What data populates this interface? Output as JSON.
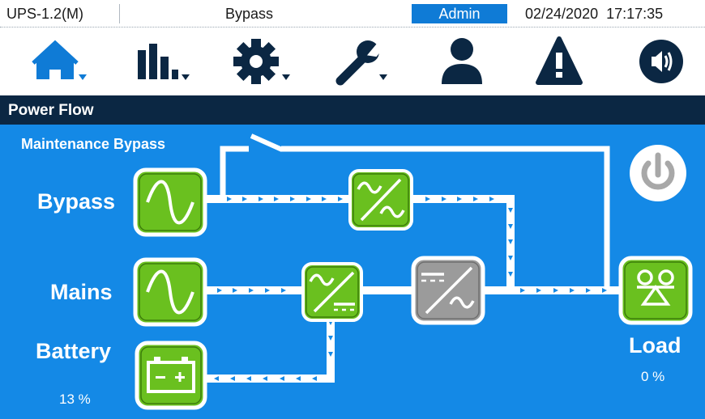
{
  "status_bar": {
    "model": "UPS-1.2(M)",
    "mode": "Bypass",
    "user": "Admin",
    "datetime": "02/24/2020  17:17:35"
  },
  "nav": {
    "items": [
      {
        "icon": "home-icon",
        "has_dropdown": true,
        "active": true
      },
      {
        "icon": "bar-chart-icon",
        "has_dropdown": true
      },
      {
        "icon": "gear-icon",
        "has_dropdown": true
      },
      {
        "icon": "wrench-icon",
        "has_dropdown": true
      },
      {
        "icon": "user-icon",
        "has_dropdown": false
      },
      {
        "icon": "warning-icon",
        "has_dropdown": false
      },
      {
        "icon": "speaker-icon",
        "has_dropdown": false
      }
    ]
  },
  "panel": {
    "title": "Power Flow"
  },
  "diagram": {
    "maintenance_bypass_label": "Maintenance Bypass",
    "bypass_label": "Bypass",
    "mains_label": "Mains",
    "battery_label": "Battery",
    "battery_percent": "13 %",
    "load_label": "Load",
    "load_percent": "0 %",
    "components": [
      {
        "name": "bypass-source",
        "icon": "ac-sine-icon",
        "state": "active"
      },
      {
        "name": "mains-source",
        "icon": "ac-sine-icon",
        "state": "active"
      },
      {
        "name": "battery",
        "icon": "battery-icon",
        "state": "active"
      },
      {
        "name": "bypass-static-switch",
        "icon": "ac-ac-converter-icon",
        "state": "active"
      },
      {
        "name": "rectifier",
        "icon": "ac-dc-converter-icon",
        "state": "active"
      },
      {
        "name": "inverter",
        "icon": "dc-ac-converter-icon",
        "state": "inactive"
      },
      {
        "name": "load",
        "icon": "load-icon",
        "state": "active"
      },
      {
        "name": "power-button",
        "icon": "power-icon"
      }
    ]
  },
  "colors": {
    "nav_icon": "#0b2743",
    "nav_active_icon": "#0f7bd6",
    "header_bg": "#0b2743",
    "diagram_bg": "#1489e6",
    "active_block": "#6ac01f",
    "inactive_block": "#9b9b9b",
    "line": "#ffffff",
    "arrow": "#1489e6"
  }
}
